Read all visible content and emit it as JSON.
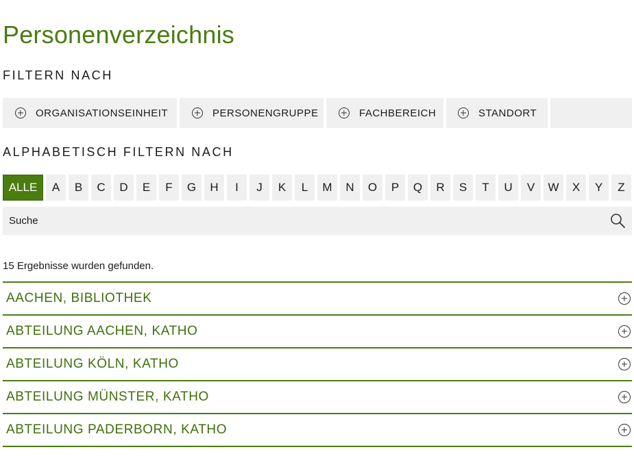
{
  "page": {
    "title": "Personenverzeichnis"
  },
  "filters": {
    "heading": "FILTERN NACH",
    "items": [
      {
        "label": "ORGANISATIONSEINHEIT"
      },
      {
        "label": "PERSONENGRUPPE"
      },
      {
        "label": "FACHBEREICH"
      },
      {
        "label": "STANDORT"
      }
    ]
  },
  "alphabet": {
    "heading": "ALPHABETISCH FILTERN NACH",
    "active": "ALLE",
    "letters": [
      "ALLE",
      "A",
      "B",
      "C",
      "D",
      "E",
      "F",
      "G",
      "H",
      "I",
      "J",
      "K",
      "L",
      "M",
      "N",
      "O",
      "P",
      "Q",
      "R",
      "S",
      "T",
      "U",
      "V",
      "W",
      "X",
      "Y",
      "Z"
    ]
  },
  "search": {
    "placeholder": "Suche",
    "icon": "search-icon"
  },
  "results": {
    "count_text": "15 Ergebnisse wurden gefunden.",
    "items": [
      {
        "label": "AACHEN, BIBLIOTHEK"
      },
      {
        "label": "ABTEILUNG AACHEN, KATHO"
      },
      {
        "label": "ABTEILUNG KÖLN, KATHO"
      },
      {
        "label": "ABTEILUNG MÜNSTER, KATHO"
      },
      {
        "label": "ABTEILUNG PADERBORN, KATHO"
      }
    ]
  },
  "colors": {
    "accent": "#4a7c10",
    "button_bg": "#f0f0f0",
    "text": "#1a1a1a"
  }
}
